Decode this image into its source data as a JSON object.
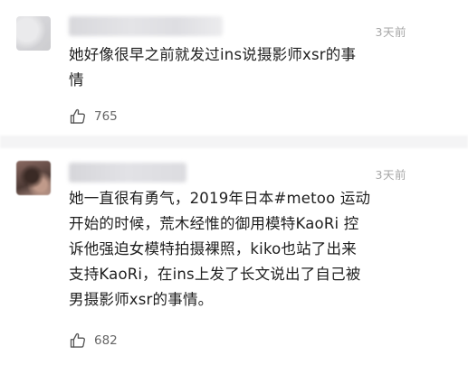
{
  "comments": [
    {
      "timestamp": "3天前",
      "text_lines": [
        "她好像很早之前就发过ins说摄影师xsr的事",
        "情"
      ],
      "likes": "765",
      "icon": "thumbs-up-icon"
    },
    {
      "timestamp": "3天前",
      "text_lines": [
        "她一直很有勇气，2019年日本#metoo 运动",
        "开始的时候，荒木经惟的御用模特KaoRi 控",
        "诉他强迫女模特拍摄裸照，kiko也站了出来",
        "支持KaoRi，在ins上发了长文说出了自己被",
        "男摄影师xsr的事情。"
      ],
      "likes": "682",
      "icon": "thumbs-up-icon"
    }
  ],
  "colors": {
    "timestamp": "#a6a6a6",
    "text": "#1f1f1f",
    "like_count": "#666666",
    "background": "#ffffff"
  }
}
